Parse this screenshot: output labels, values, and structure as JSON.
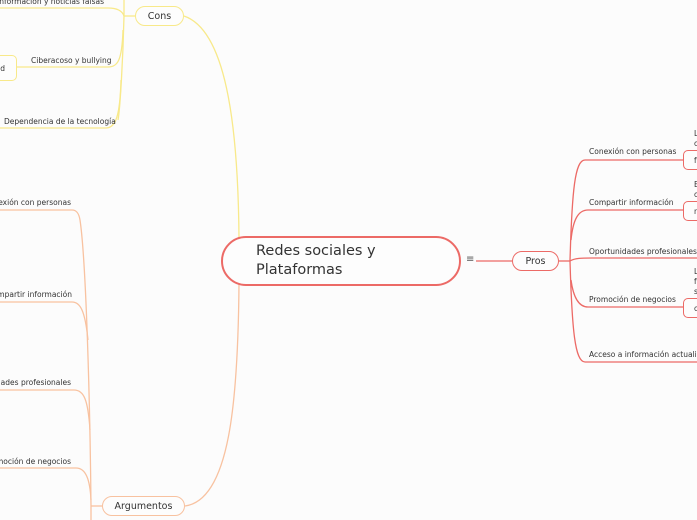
{
  "central_topic": {
    "line1": "Redes sociales y",
    "line2": "Plataformas",
    "menu_icon": "≡"
  },
  "colors": {
    "cons": "#f8e98a",
    "pros": "#ec6a66",
    "argumentos": "#f8c2a0",
    "central": "#ec6a66"
  },
  "cons": {
    "label": "Cons",
    "items": [
      {
        "label": "Desinformación y noticias falsas"
      },
      {
        "label": "Ciberacoso y bullying",
        "child_partial": "d"
      },
      {
        "label": "Dependencia de la tecnología"
      }
    ]
  },
  "pros": {
    "label": "Pros",
    "items": [
      {
        "label": "Conexión con personas",
        "child_partial": [
          "L",
          "c",
          "f"
        ]
      },
      {
        "label": "Compartir información",
        "child_partial": [
          "E",
          "c",
          "n"
        ]
      },
      {
        "label": "Oportunidades profesionales"
      },
      {
        "label": "Promoción de negocios",
        "child_partial": [
          "L",
          "f",
          "s",
          "c"
        ]
      },
      {
        "label": "Acceso a información actualizada"
      }
    ]
  },
  "argumentos": {
    "label": "Argumentos",
    "items": [
      {
        "label": "Conexión con personas"
      },
      {
        "label": "Compartir información"
      },
      {
        "label": "Oportunidades profesionales"
      },
      {
        "label": "Promoción de negocios"
      }
    ]
  }
}
